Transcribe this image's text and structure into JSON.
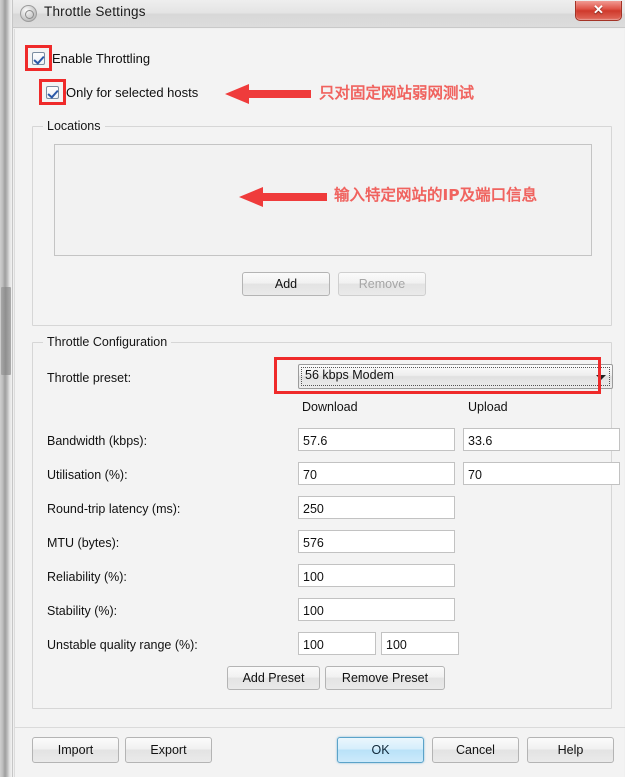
{
  "window": {
    "title": "Throttle Settings",
    "app_icon": "throttle-app-icon",
    "close_label": "✕"
  },
  "options": {
    "enable_throttling": {
      "label": "Enable Throttling",
      "checked": true
    },
    "only_selected_hosts": {
      "label": "Only for selected hosts",
      "checked": true
    }
  },
  "annotations": [
    {
      "id": "anno-hosts",
      "text": "只对固定网站弱网测试",
      "color": "#f0635f"
    },
    {
      "id": "anno-locations",
      "text": "输入特定网站的IP及端口信息",
      "color": "#f0635f"
    }
  ],
  "locations": {
    "group_title": "Locations",
    "list_items": [],
    "add_label": "Add",
    "remove_label": "Remove",
    "remove_enabled": false
  },
  "throttle_config": {
    "group_title": "Throttle Configuration",
    "preset_label": "Throttle preset:",
    "preset_value": "56 kbps Modem",
    "col_download": "Download",
    "col_upload": "Upload",
    "rows": [
      {
        "label": "Bandwidth (kbps):",
        "download": "57.6",
        "upload": "33.6"
      },
      {
        "label": "Utilisation (%):",
        "download": "70",
        "upload": "70"
      },
      {
        "label": "Round-trip latency (ms):",
        "download": "250",
        "upload": null
      },
      {
        "label": "MTU (bytes):",
        "download": "576",
        "upload": null
      },
      {
        "label": "Reliability (%):",
        "download": "100",
        "upload": null
      },
      {
        "label": "Stability (%):",
        "download": "100",
        "upload": null
      },
      {
        "label": "Unstable quality range (%):",
        "download": "100",
        "upload": "100"
      }
    ],
    "add_preset_label": "Add Preset",
    "remove_preset_label": "Remove Preset"
  },
  "footer": {
    "import_label": "Import",
    "export_label": "Export",
    "ok_label": "OK",
    "cancel_label": "Cancel",
    "help_label": "Help"
  },
  "colors": {
    "annotation_red": "#ef2a2a",
    "annotation_text": "#f0635f",
    "default_button_blue": "#b9e2f8",
    "close_button_red": "#cf3a2c"
  }
}
